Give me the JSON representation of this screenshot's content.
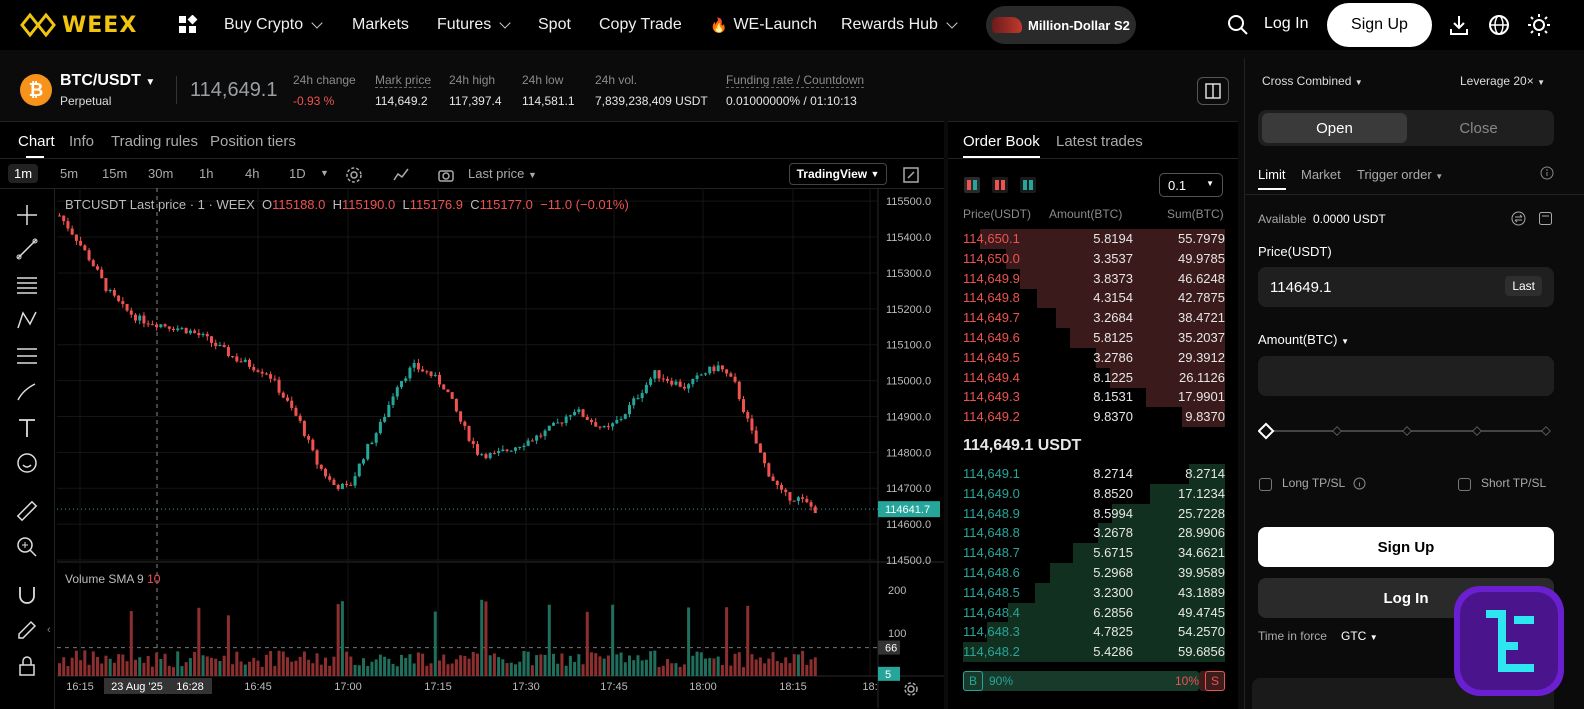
{
  "nav": {
    "brand": "WEEX",
    "items": [
      "Buy Crypto",
      "Markets",
      "Futures",
      "Spot",
      "Copy Trade",
      "WE-Launch",
      "Rewards Hub"
    ],
    "promo": "Million-Dollar S2",
    "login": "Log In",
    "signup": "Sign Up"
  },
  "ticker": {
    "pair": "BTC/USDT",
    "type": "Perpetual",
    "last_price": "114,649.1",
    "stats": [
      {
        "label": "24h change",
        "value": "-0.93 %"
      },
      {
        "label": "Mark price",
        "value": "114,649.2"
      },
      {
        "label": "24h high",
        "value": "117,397.4"
      },
      {
        "label": "24h low",
        "value": "114,581.1"
      },
      {
        "label": "24h vol.",
        "value": "7,839,238,409 USDT"
      },
      {
        "label": "Funding rate / Countdown",
        "value": "0.01000000% / 01:10:13"
      }
    ]
  },
  "chart_tabs": [
    "Chart",
    "Info",
    "Trading rules",
    "Position tiers"
  ],
  "timeframes": [
    "1m",
    "5m",
    "15m",
    "30m",
    "1h",
    "4h",
    "1D"
  ],
  "toolbar": {
    "price_type": "Last price",
    "tradingview": "TradingView"
  },
  "legend": {
    "symbol": "BTCUSDT Last price · 1 · WEEX",
    "o_label": "O",
    "o": "115188.0",
    "h_label": "H",
    "h": "115190.0",
    "l_label": "L",
    "l": "115176.9",
    "c_label": "C",
    "c": "115177.0",
    "change": "−11.0 (−0.01%)"
  },
  "volume_legend": {
    "label": "Volume SMA 9",
    "value": "10"
  },
  "chart_data": {
    "type": "candlestick",
    "y_ticks": [
      "115500.0",
      "115400.0",
      "115300.0",
      "115200.0",
      "115100.0",
      "115000.0",
      "114900.0",
      "114800.0",
      "114700.0",
      "114600.0",
      "114500.0"
    ],
    "ylim": [
      114500,
      115520
    ],
    "current_price_label": "114641.7",
    "current_price": 114641.7,
    "volume_ticks": [
      "200",
      "100"
    ],
    "volume_ylim": [
      0,
      260
    ],
    "volume_markers": [
      "66",
      "5"
    ],
    "volume_marker_values": [
      66,
      5
    ],
    "x_ticks": [
      "16:15",
      "23 Aug '25",
      "16:28",
      "16:45",
      "17:00",
      "17:15",
      "17:30",
      "17:45",
      "18:00",
      "18:15",
      "18:"
    ],
    "close_path": [
      115460,
      115400,
      115330,
      115250,
      115200,
      115170,
      115160,
      115150,
      115140,
      115120,
      115090,
      115060,
      115040,
      115020,
      114950,
      114880,
      114770,
      114710,
      114700,
      114800,
      114880,
      114990,
      115040,
      115020,
      114980,
      114880,
      114800,
      114790,
      114810,
      114830,
      114850,
      114880,
      114920,
      114890,
      114860,
      114900,
      114960,
      115020,
      115000,
      114980,
      115020,
      115040,
      114990,
      114860,
      114750,
      114680,
      114670,
      114640
    ]
  },
  "orderbook": {
    "tabs": [
      "Order Book",
      "Latest trades"
    ],
    "precision": "0.1",
    "headers": [
      "Price(USDT)",
      "Amount(BTC)",
      "Sum(BTC)"
    ],
    "asks": [
      [
        "114,650.1",
        "5.8194",
        "55.7979"
      ],
      [
        "114,650.0",
        "3.3537",
        "49.9785"
      ],
      [
        "114,649.9",
        "3.8373",
        "46.6248"
      ],
      [
        "114,649.8",
        "4.3154",
        "42.7875"
      ],
      [
        "114,649.7",
        "3.2684",
        "38.4721"
      ],
      [
        "114,649.6",
        "5.8125",
        "35.2037"
      ],
      [
        "114,649.5",
        "3.2786",
        "29.3912"
      ],
      [
        "114,649.4",
        "8.1225",
        "26.1126"
      ],
      [
        "114,649.3",
        "8.1531",
        "17.9901"
      ],
      [
        "114,649.2",
        "9.8370",
        "9.8370"
      ]
    ],
    "mid": "114,649.1 USDT",
    "bids": [
      [
        "114,649.1",
        "8.2714",
        "8.2714"
      ],
      [
        "114,649.0",
        "8.8520",
        "17.1234"
      ],
      [
        "114,648.9",
        "8.5994",
        "25.7228"
      ],
      [
        "114,648.8",
        "3.2678",
        "28.9906"
      ],
      [
        "114,648.7",
        "5.6715",
        "34.6621"
      ],
      [
        "114,648.6",
        "5.2968",
        "39.9589"
      ],
      [
        "114,648.5",
        "3.2300",
        "43.1889"
      ],
      [
        "114,648.4",
        "6.2856",
        "49.4745"
      ],
      [
        "114,648.3",
        "4.7825",
        "54.2570"
      ],
      [
        "114,648.2",
        "5.4286",
        "59.6856"
      ]
    ],
    "buy_label": "B",
    "buy_pct": "90%",
    "sell_label": "S",
    "sell_pct": "10%",
    "buy_ratio": 0.9
  },
  "form": {
    "margin_mode": "Cross Combined",
    "leverage": "Leverage 20×",
    "open": "Open",
    "close": "Close",
    "order_tabs": [
      "Limit",
      "Market",
      "Trigger order"
    ],
    "available_label": "Available",
    "available": "0.0000 USDT",
    "price_label": "Price(USDT)",
    "price_value": "114649.1",
    "price_tag": "Last",
    "amount_label": "Amount(BTC)",
    "long_tpsl": "Long TP/SL",
    "short_tpsl": "Short TP/SL",
    "signup": "Sign Up",
    "login": "Log In",
    "tif_label": "Time in force",
    "tif_value": "GTC"
  },
  "colors": {
    "up": "#26a69a",
    "down": "#ef5350",
    "brand": "#f1c40f"
  }
}
